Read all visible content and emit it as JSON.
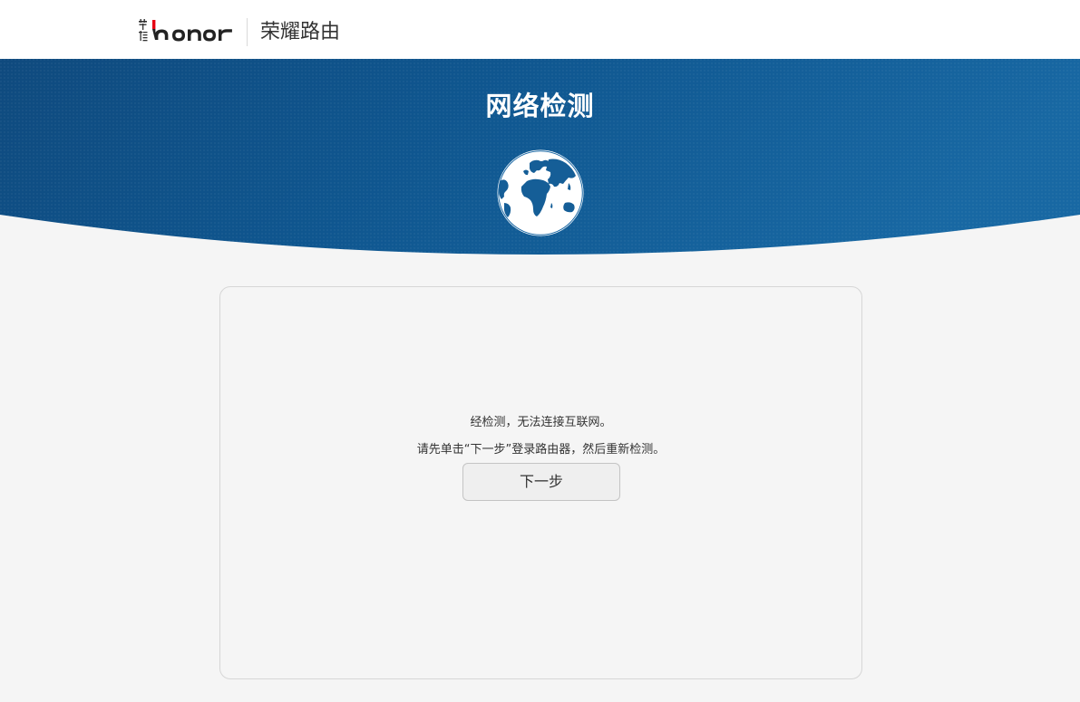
{
  "header": {
    "logo_text": "honor",
    "logo_seal_text": "荣耀",
    "product_name": "荣耀路由"
  },
  "banner": {
    "title": "网络检测",
    "icon": "globe-icon"
  },
  "card": {
    "message_line1": "经检测，无法连接互联网。",
    "message_line2": "请先单击“下一步”登录路由器，然后重新检测。",
    "next_button_label": "下一步"
  },
  "colors": {
    "banner_dark": "#0d4f85",
    "banner_light": "#1a6fa8",
    "logo_accent": "#e60012",
    "background": "#f5f5f5"
  }
}
